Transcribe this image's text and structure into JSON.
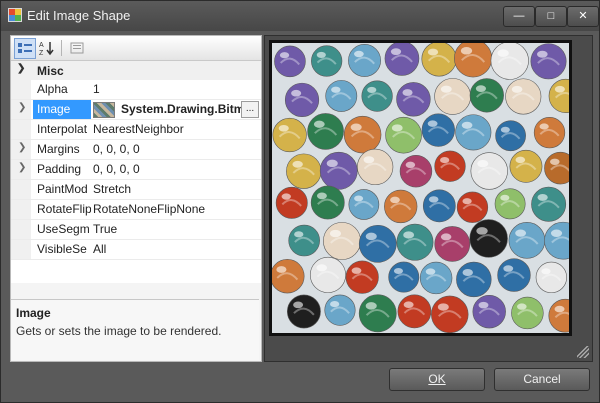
{
  "window": {
    "title": "Edit Image Shape"
  },
  "toolbar": {
    "categorized": "categorized-view",
    "alphabetical": "alphabetical-view",
    "pages": "property-pages"
  },
  "grid": {
    "category": "Misc",
    "rows": [
      {
        "name": "Alpha",
        "value": "1"
      },
      {
        "name": "Image",
        "value": "System.Drawing.Bitma"
      },
      {
        "name": "Interpolat",
        "value": "NearestNeighbor"
      },
      {
        "name": "Margins",
        "value": "0, 0, 0, 0"
      },
      {
        "name": "Padding",
        "value": "0, 0, 0, 0"
      },
      {
        "name": "PaintMod",
        "value": "Stretch"
      },
      {
        "name": "RotateFlip",
        "value": "RotateNoneFlipNone"
      },
      {
        "name": "UseSegm",
        "value": "True"
      },
      {
        "name": "VisibleSe",
        "value": "All"
      }
    ]
  },
  "help": {
    "title": "Image",
    "text": "Gets or sets the image to be rendered."
  },
  "buttons": {
    "ok": "OK",
    "cancel": "Cancel"
  }
}
